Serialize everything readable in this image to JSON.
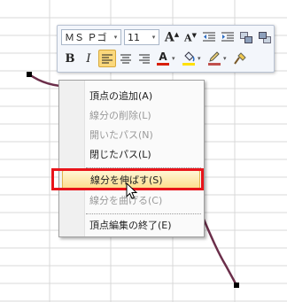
{
  "mini_toolbar": {
    "font_name": "ＭＳ Ｐゴ",
    "font_size": "11",
    "grow_font_label": "A",
    "shrink_font_label": "A",
    "bold_label": "B",
    "italic_label": "I",
    "font_color_label": "A",
    "font_color": "#d81e06",
    "fill_color": "#ffe000",
    "line_color": "#c0504d",
    "dropdown_glyph": "▾"
  },
  "context_menu": {
    "items": [
      {
        "label": "頂点の追加(A)",
        "enabled": true
      },
      {
        "label": "線分の削除(L)",
        "enabled": false
      },
      {
        "label": "開いたパス(N)",
        "enabled": false
      },
      {
        "label": "閉じたパス(L)",
        "enabled": true
      },
      {
        "label": "線分を伸ばす(S)",
        "enabled": true,
        "highlighted": true
      },
      {
        "label": "線分を曲げる(C)",
        "enabled": false
      },
      {
        "label": "頂点編集の終了(E)",
        "enabled": true
      }
    ]
  },
  "colors": {
    "curve": "#6b2e4a",
    "highlight_box": "#e8141a",
    "gridline": "#d9d9d9"
  }
}
